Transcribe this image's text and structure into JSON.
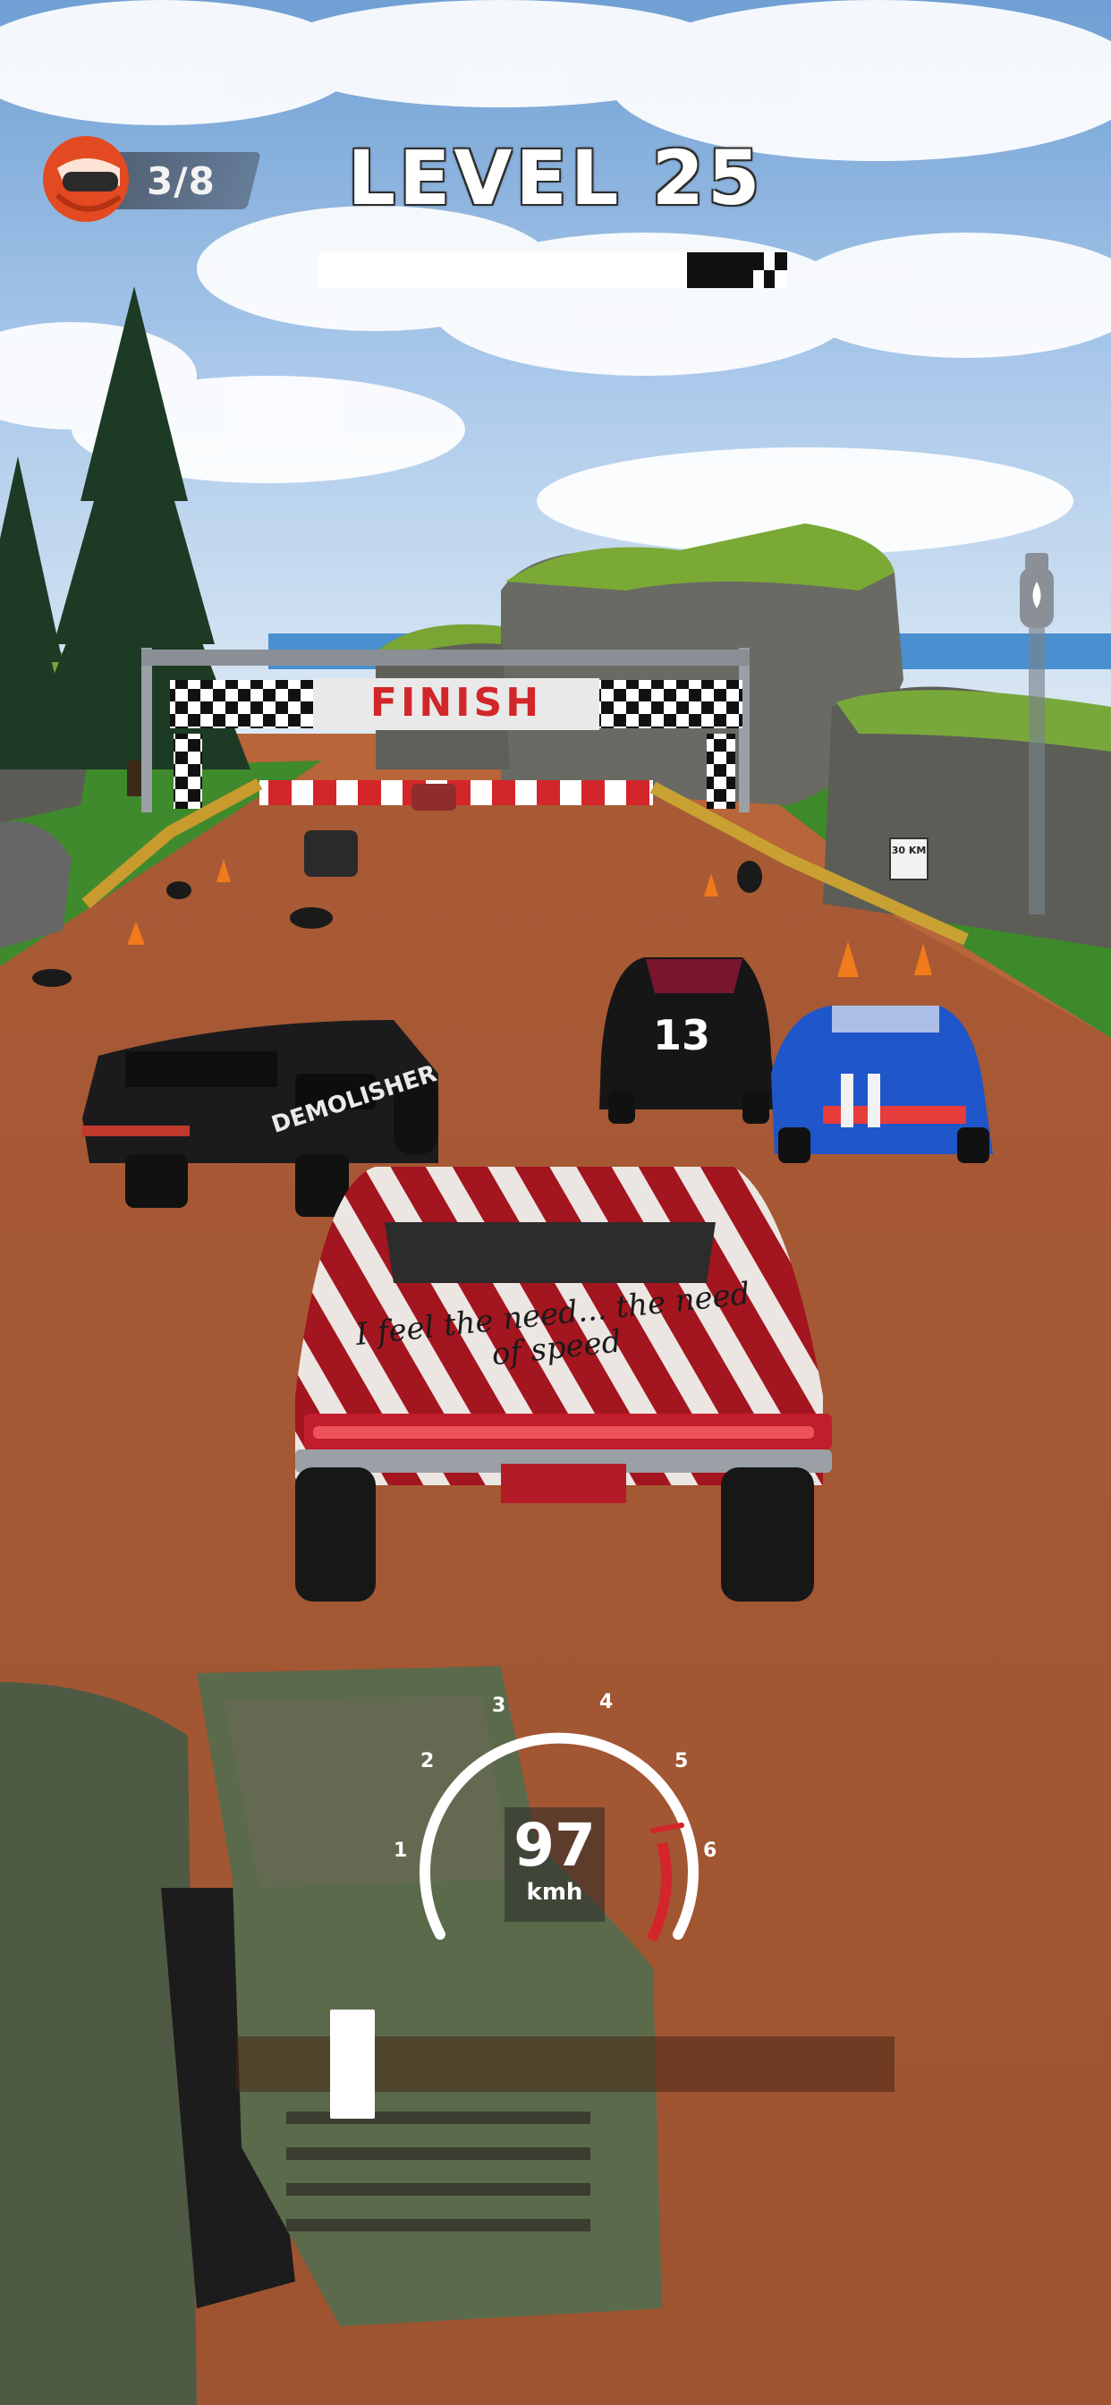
{
  "hud": {
    "opponents_count": "3/8",
    "level_title": "LEVEL 25",
    "level_progress": 0.74
  },
  "scene": {
    "finish_banner": "FINISH",
    "speed_sign": "30 KM",
    "car_decal_main": "I feel the need... the need of speed",
    "car_decal_left": "DEMOLISHER",
    "car_number": "13"
  },
  "speedometer": {
    "speed": "97",
    "unit": "kmh",
    "ticks": [
      "1",
      "2",
      "3",
      "4",
      "5",
      "6"
    ],
    "needle_fraction": 0.82
  },
  "steering": {
    "position": 0.08
  },
  "colors": {
    "accent_red": "#d3262a",
    "road": "#b8653a",
    "sky": "#8fb9e3"
  }
}
